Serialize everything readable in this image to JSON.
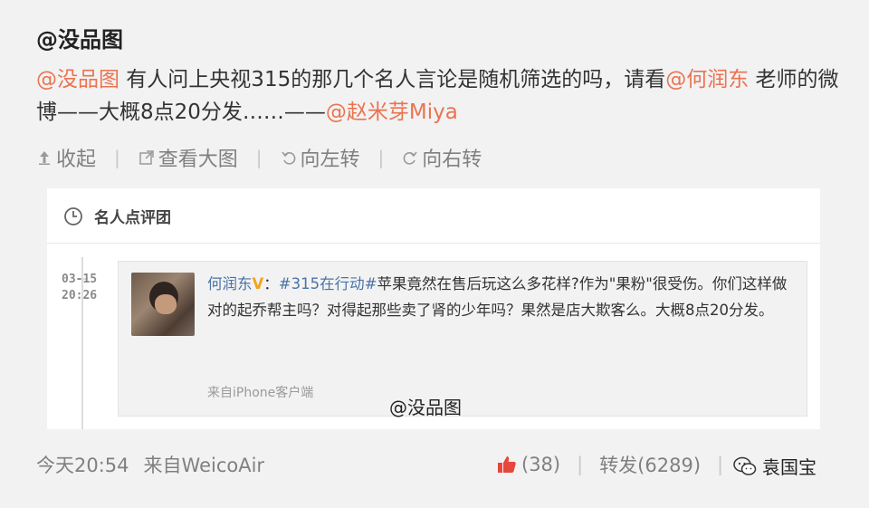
{
  "post": {
    "author": "@没品图",
    "mention1": "@没品图",
    "text1": " 有人问上央视315的那几个名人言论是随机筛选的吗，请看",
    "mention2": "@何润东",
    "text2": " 老师的微博——大概8点20分发……——",
    "mention3": "@赵米芽Miya"
  },
  "actions": {
    "collapse": "收起",
    "view_large": "查看大图",
    "rotate_left": "向左转",
    "rotate_right": "向右转",
    "separator": "|"
  },
  "card": {
    "header": "名人点评团",
    "date_line1": "03-15",
    "date_line2": "20:26",
    "tweet_author": "何润东",
    "vbadge": "V",
    "colon": "：",
    "hashtag": "#315在行动#",
    "tweet_text": "苹果竟然在售后玩这么多花样?作为\"果粉\"很受伤。你们这样做对的起乔帮主吗？对得起那些卖了肾的少年吗？果然是店大欺客么。大概8点20分发。",
    "source": "来自iPhone客户端",
    "watermark": "@没品图"
  },
  "footer": {
    "time": "今天20:54",
    "source": "来自WeicoAir",
    "likes": "(38)",
    "repost_label": "转发(6289)",
    "separator": "|",
    "wechat_watermark": "袁国宝"
  },
  "colors": {
    "mention": "#eb7350",
    "link_blue": "#4a73a8",
    "verified": "#f3a41c",
    "like_red": "#e8453c"
  },
  "icons": [
    "collapse-arrow-icon",
    "external-link-icon",
    "rotate-left-icon",
    "rotate-right-icon",
    "clock-icon",
    "thumbs-up-icon",
    "wechat-icon"
  ]
}
